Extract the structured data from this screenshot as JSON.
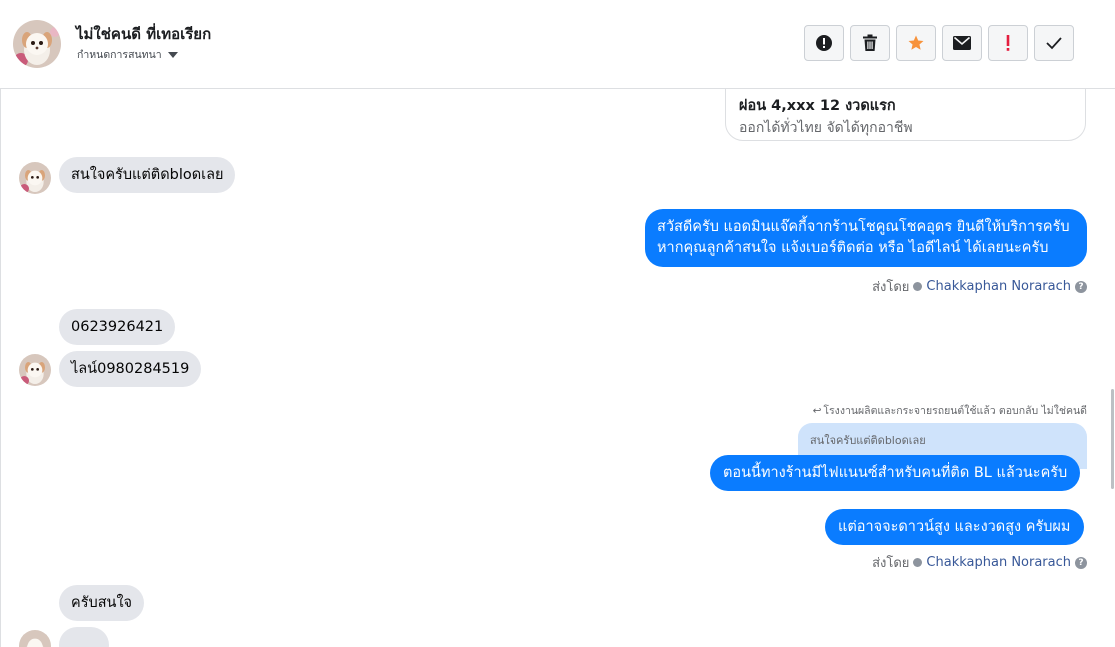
{
  "header": {
    "contact_name": "ไม่ใช่คนดี ที่เทอเรียก",
    "subtitle": "กำหนดการสนทนา",
    "actions": [
      {
        "name": "report-icon"
      },
      {
        "name": "trash-icon"
      },
      {
        "name": "star-icon"
      },
      {
        "name": "mail-icon"
      },
      {
        "name": "exclamation-icon"
      },
      {
        "name": "check-icon"
      }
    ]
  },
  "colors": {
    "accent": "#0a7cff",
    "star": "#f7923b",
    "spam": "#e41e3f",
    "bubble_in": "#e4e6eb"
  },
  "card": {
    "title": "ผ่อน 4,xxx 12 งวดแรก",
    "subtitle": "ออกได้ทั่วไทย จัดได้ทุกอาชีพ"
  },
  "messages": {
    "in1": "สนใจครับแต่ติดbloดเลย",
    "out1_line1": "สวัสดีครับ แอดมินแจ๊คกี้จากร้านโชคูณโชคอุดร ยินดีให้บริการครับ",
    "out1_line2": "หากคุณลูกค้าสนใจ แจ้งเบอร์ติดต่อ หรือ ไอดีไลน์ ได้เลยนะครับ",
    "in2": "0623926421",
    "in3": "ไลน์0980284519",
    "reply_note": "โรงงานผลิตและกระจายรถยนต์ใช้แล้ว ตอบกลับ ไม่ใช่คนดี",
    "quoted": "สนใจครับแต่ติดbloดเลย",
    "out2": "ตอนนี้ทางร้านมีไฟแนนซ์สำหรับคนที่ติด BL แล้วนะครับ",
    "out3": "แต่อาจจะดาวน์สูง และงวดสูง ครับผม",
    "in4": "ครับสนใจ"
  },
  "sent_by": {
    "label": "ส่งโดย",
    "agent": "Chakkaphan Norarach",
    "help": "?"
  }
}
